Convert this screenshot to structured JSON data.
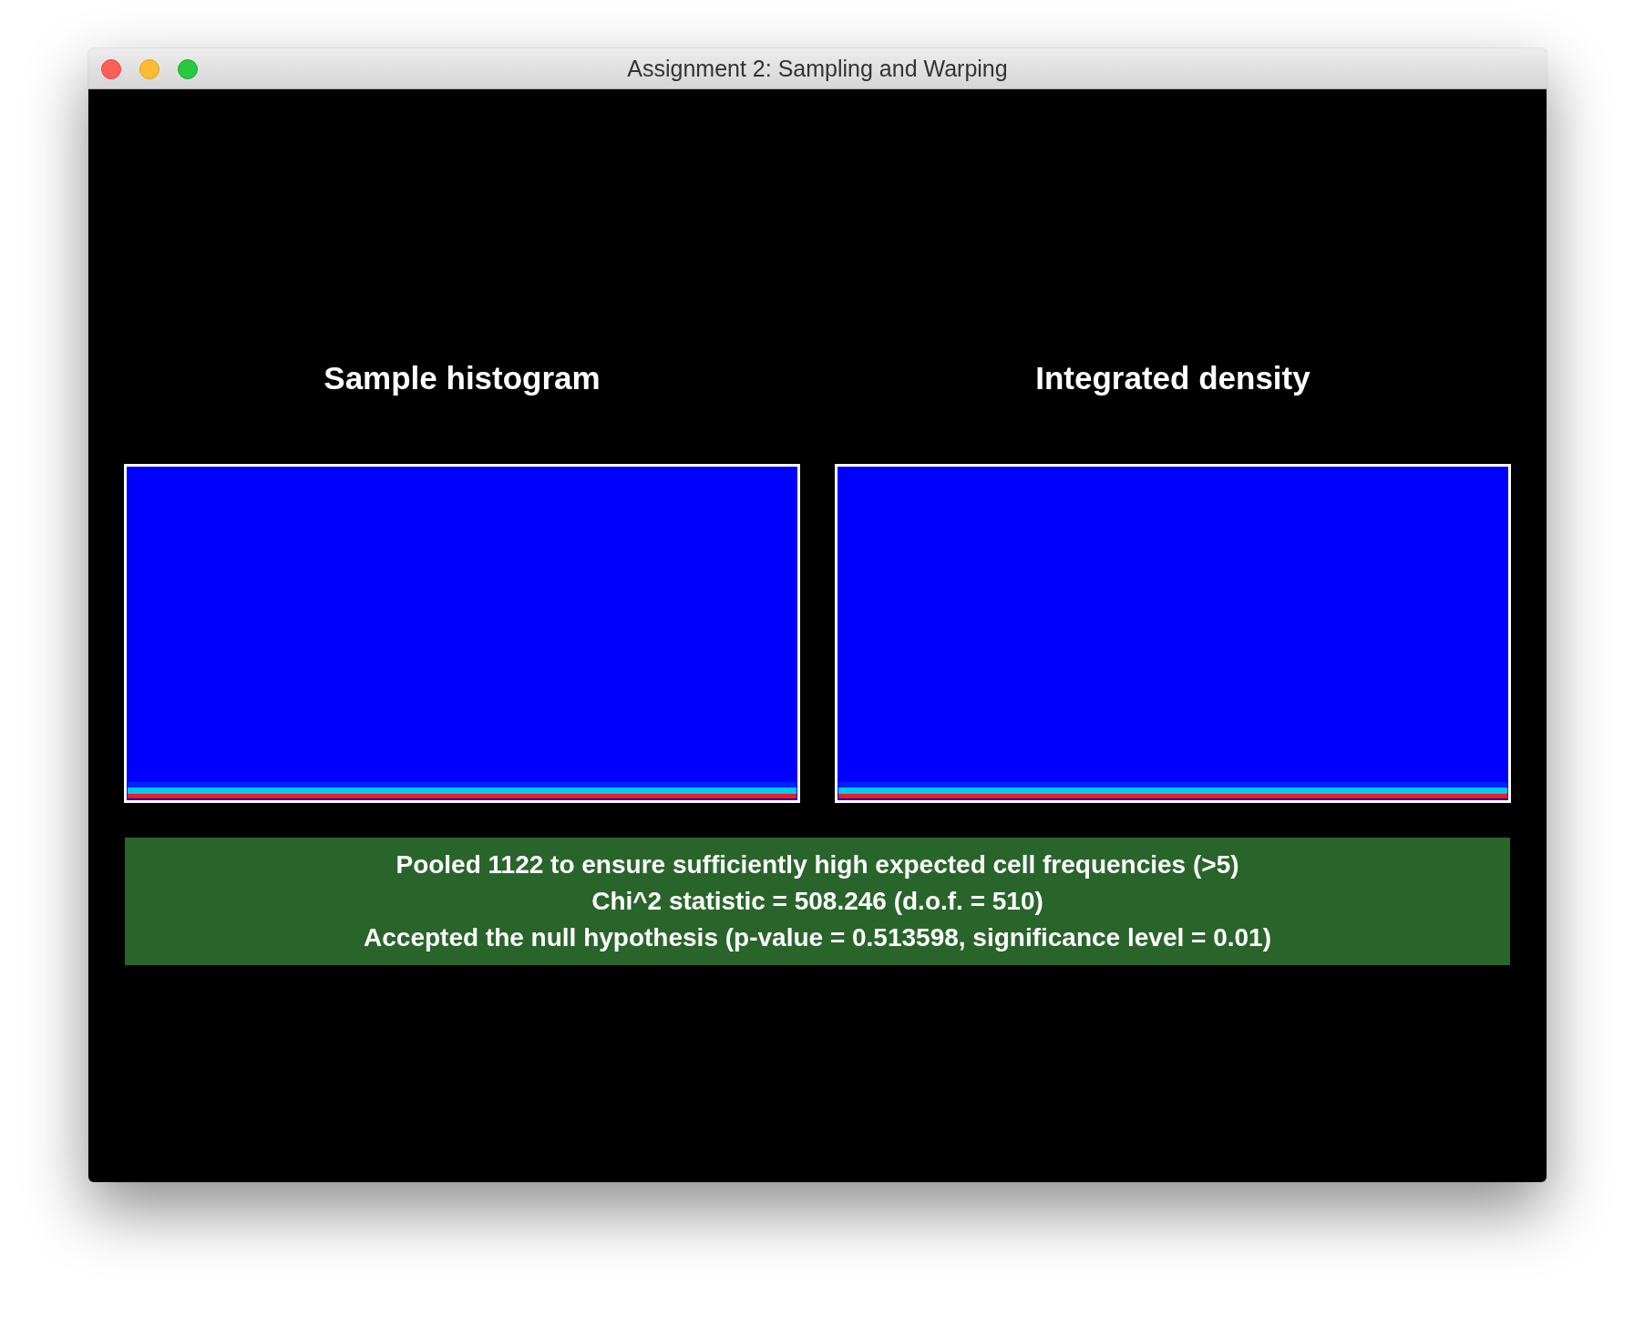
{
  "window": {
    "title": "Assignment 2: Sampling and Warping"
  },
  "panels": [
    {
      "title": "Sample histogram"
    },
    {
      "title": "Integrated density"
    }
  ],
  "result": {
    "accepted": true,
    "lines": [
      "Pooled 1122 to ensure sufficiently high expected cell frequencies (>5)",
      "Chi^2 statistic = 508.246 (d.o.f. = 510)",
      "Accepted the null hypothesis (p-value = 0.513598, significance level = 0.01)"
    ]
  }
}
